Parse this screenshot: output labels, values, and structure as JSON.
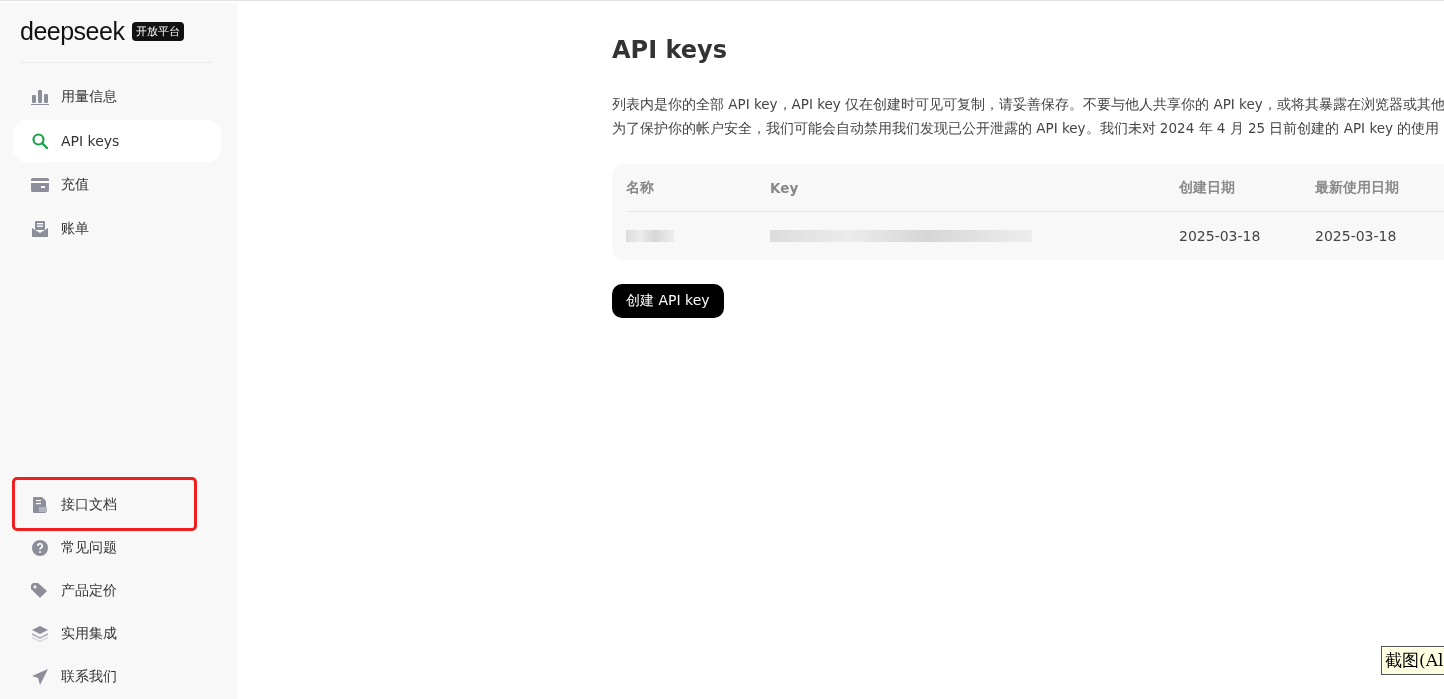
{
  "sidebar": {
    "logo": "deepseek",
    "badge": "开放平台",
    "items": [
      {
        "label": "用量信息",
        "kind": "usage",
        "selected": false,
        "highlighted": false
      },
      {
        "label": "API keys",
        "kind": "key",
        "selected": true,
        "highlighted": false
      },
      {
        "label": "充值",
        "kind": "wallet",
        "selected": false,
        "highlighted": false
      },
      {
        "label": "账单",
        "kind": "bill",
        "selected": false,
        "highlighted": false
      }
    ],
    "bottom_items": [
      {
        "label": "接口文档",
        "kind": "doc",
        "selected": false,
        "highlighted": true
      },
      {
        "label": "常见问题",
        "kind": "help",
        "selected": false,
        "highlighted": false
      },
      {
        "label": "产品定价",
        "kind": "tag",
        "selected": false,
        "highlighted": false
      },
      {
        "label": "实用集成",
        "kind": "layers",
        "selected": false,
        "highlighted": false
      },
      {
        "label": "联系我们",
        "kind": "send",
        "selected": false,
        "highlighted": false
      }
    ]
  },
  "main": {
    "title": "API keys",
    "description": [
      "列表内是你的全部 API key，API key 仅在创建时可见可复制，请妥善保存。不要与他人共享你的 API key，或将其暴露在浏览器或其他",
      "为了保护你的帐户安全，我们可能会自动禁用我们发现已公开泄露的 API key。我们未对 2024 年 4 月 25 日前创建的 API key 的使用"
    ],
    "table": {
      "columns": [
        "名称",
        "Key",
        "创建日期",
        "最新使用日期"
      ],
      "rows": [
        {
          "created": "2025-03-18",
          "last_used": "2025-03-18"
        }
      ]
    },
    "create_button": "创建 API key"
  },
  "tooltip": "截图(Al"
}
